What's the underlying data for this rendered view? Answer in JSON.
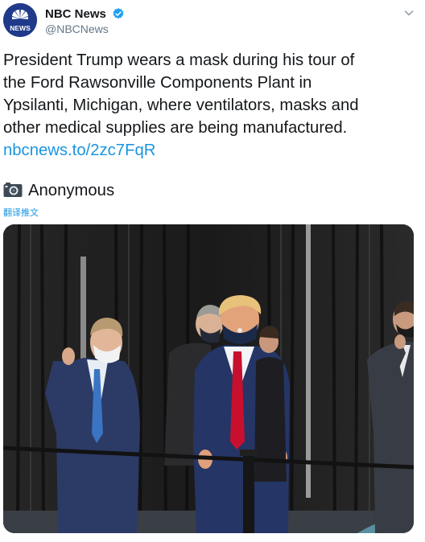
{
  "account": {
    "display_name": "NBC News",
    "handle": "@NBCNews",
    "avatar_label": "NEWS",
    "verified": true,
    "accent_color": "#1da1f2",
    "link_color": "#1b95e0"
  },
  "tweet": {
    "lines": [
      "President Trump wears a mask during his tour of",
      "the Ford Rawsonville Components Plant in",
      "Ypsilanti, Michigan, where ventilators, masks and",
      "other medical supplies are being manufactured."
    ],
    "link_text": "nbcnews.to/2zc7FqR",
    "photo_credit_icon": "camera-icon",
    "photo_credit": "Anonymous",
    "translate_label": "翻译推文"
  },
  "media": {
    "type": "photo",
    "icon": "photo"
  }
}
